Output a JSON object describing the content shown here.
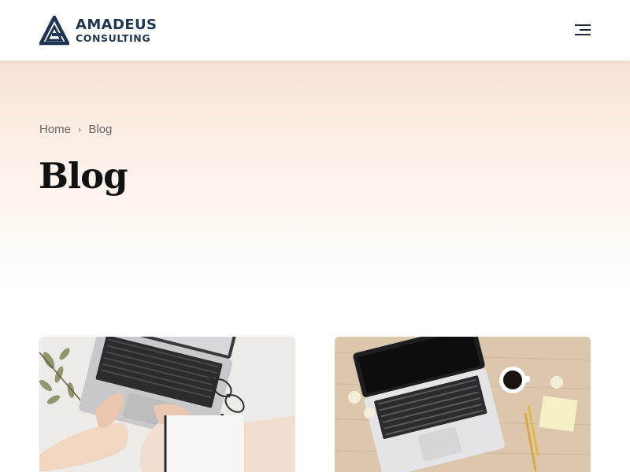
{
  "header": {
    "logo_line1": "AMADEUS",
    "logo_line2": "CONSULTING",
    "brand_color": "#1f3551",
    "menu_icon": "hamburger-menu-icon"
  },
  "breadcrumb": {
    "home": "Home",
    "current": "Blog",
    "separator": "›"
  },
  "page": {
    "title": "Blog"
  },
  "posts": [
    {
      "image": "laptop-typing-hands-photo"
    },
    {
      "image": "laptop-on-wooden-desk-photo"
    }
  ],
  "colors": {
    "hero_gradient_top": "#f8e3d5",
    "title": "#111111",
    "breadcrumb": "#666666"
  }
}
